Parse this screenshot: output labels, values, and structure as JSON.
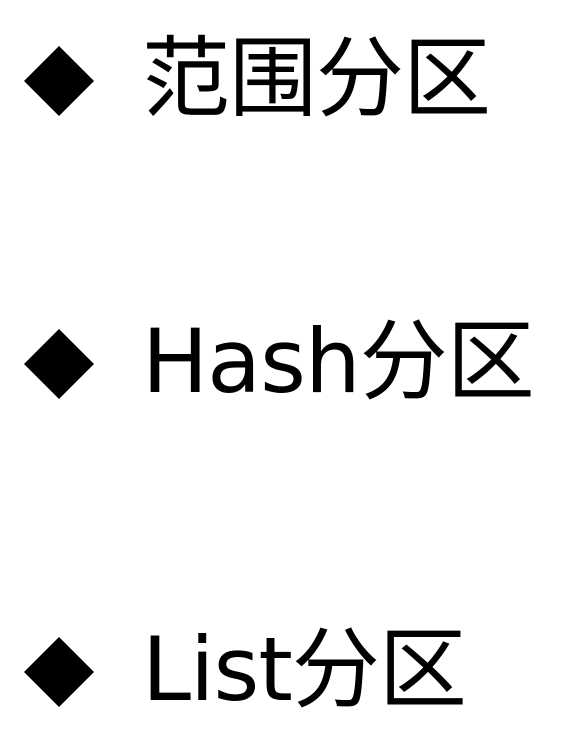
{
  "slide": {
    "bullets": [
      {
        "icon": "diamond-bullet-icon",
        "text": "范围分区"
      },
      {
        "icon": "diamond-bullet-icon",
        "text": "Hash分区"
      },
      {
        "icon": "diamond-bullet-icon",
        "text": "List分区"
      }
    ],
    "colors": {
      "background": "#ffffff",
      "text": "#000000",
      "bullet": "#000000"
    }
  }
}
